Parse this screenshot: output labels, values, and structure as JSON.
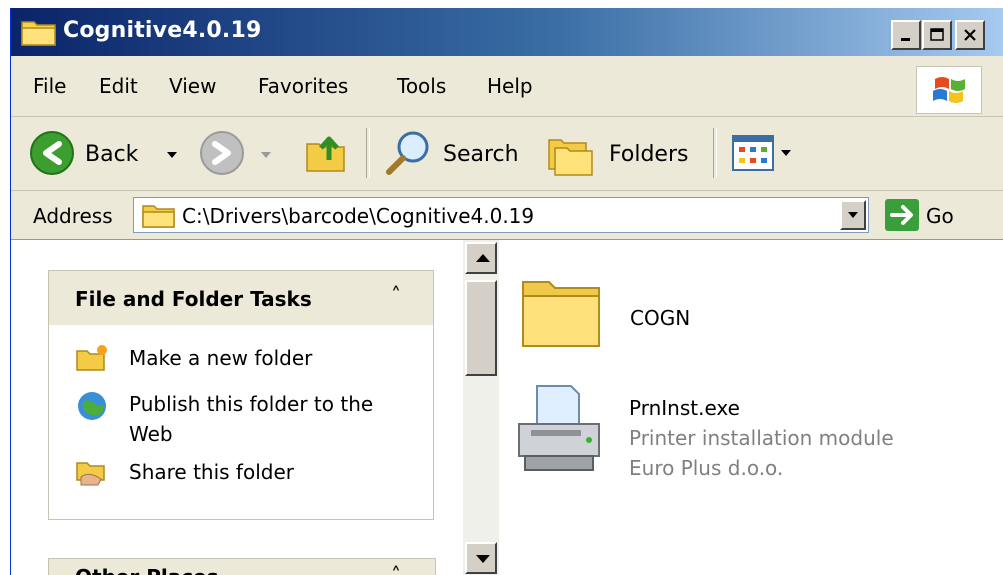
{
  "window": {
    "title": "Cognitive4.0.19",
    "caption_buttons": [
      "minimize",
      "maximize",
      "close"
    ]
  },
  "menu": {
    "items": [
      "File",
      "Edit",
      "View",
      "Favorites",
      "Tools",
      "Help"
    ]
  },
  "toolbar": {
    "back_label": "Back",
    "search_label": "Search",
    "folders_label": "Folders"
  },
  "address": {
    "label": "Address",
    "path": "C:\\Drivers\\barcode\\Cognitive4.0.19",
    "go_label": "Go"
  },
  "tasks": {
    "title": "File and Folder Tasks",
    "collapse_glyph": "˄",
    "items": [
      {
        "label": "Make a new folder",
        "icon": "new-folder-icon"
      },
      {
        "label": "Publish this folder to the Web",
        "icon": "web-publish-icon"
      },
      {
        "label": "Share this folder",
        "icon": "share-folder-icon"
      }
    ]
  },
  "other_places": {
    "title": "Other Places"
  },
  "files": [
    {
      "name": "COGN",
      "icon": "folder-icon"
    },
    {
      "name": "PrnInst.exe",
      "icon": "printer-icon",
      "description": "Printer installation module",
      "company": "Euro Plus d.o.o."
    }
  ],
  "colors": {
    "titlebar_start": "#0a246a",
    "titlebar_end": "#a6caf0",
    "chrome": "#ece9d8",
    "subtext": "#808080"
  }
}
